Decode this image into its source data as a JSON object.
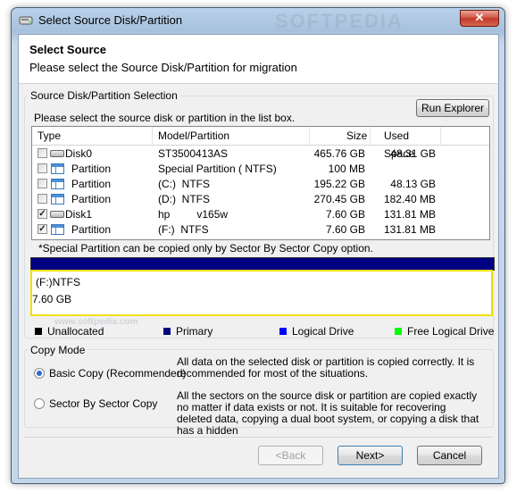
{
  "window": {
    "title": "Select Source Disk/Partition",
    "close_label": "✕"
  },
  "header": {
    "title": "Select Source",
    "subtitle": "Please select the Source Disk/Partition for migration"
  },
  "selection_group": {
    "label": "Source Disk/Partition Selection",
    "instruction": "Please select the source disk or partition in the list box.",
    "run_explorer": "Run Explorer",
    "columns": [
      "Type",
      "Model/Partition",
      "Size",
      "Used Space"
    ],
    "rows": [
      {
        "checked": false,
        "icon": "disk-icon",
        "type": "Disk0",
        "model": "ST3500413AS",
        "size": "465.76 GB",
        "used": "48.31 GB"
      },
      {
        "checked": false,
        "icon": "partition-icon",
        "type": "Partition",
        "model": "Special Partition ( NTFS)",
        "size": "100 MB",
        "used": ""
      },
      {
        "checked": false,
        "icon": "partition-icon",
        "type": "Partition",
        "model": "(C:)  NTFS",
        "size": "195.22 GB",
        "used": "48.13 GB"
      },
      {
        "checked": false,
        "icon": "partition-icon",
        "type": "Partition",
        "model": "(D:)  NTFS",
        "size": "270.45 GB",
        "used": "182.40 MB"
      },
      {
        "checked": true,
        "icon": "disk-icon",
        "type": "Disk1",
        "model": "hp         v165w",
        "size": "7.60 GB",
        "used": "131.81 MB"
      },
      {
        "checked": true,
        "icon": "partition-icon",
        "type": "Partition",
        "model": "(F:)  NTFS",
        "size": "7.60 GB",
        "used": "131.81 MB"
      }
    ],
    "note": "*Special Partition can be copied only by Sector By Sector Copy option."
  },
  "selected_info": {
    "line1": "(F:)NTFS",
    "line2": "7.60 GB"
  },
  "legend": [
    {
      "label": "Unallocated",
      "color": "#000000"
    },
    {
      "label": "Primary",
      "color": "#000080"
    },
    {
      "label": "Logical Drive",
      "color": "#0000ff"
    },
    {
      "label": "Free Logical Drive",
      "color": "#00ff00"
    }
  ],
  "copy_mode": {
    "label": "Copy Mode",
    "options": [
      {
        "label": "Basic Copy (Recommended)",
        "selected": true,
        "description": "All data on the selected disk or partition is copied correctly. It is recommended for most of the situations."
      },
      {
        "label": "Sector By Sector Copy",
        "selected": false,
        "description": "All the sectors on the source disk or partition are copied exactly no matter if data exists or not. It is suitable for recovering deleted data, copying a dual boot system, or copying a disk that has a hidden"
      }
    ]
  },
  "buttons": {
    "back": "<Back",
    "next": "Next>",
    "cancel": "Cancel"
  },
  "watermark": {
    "main": "SOFTPEDIA",
    "small": "www.softpedia.com"
  }
}
